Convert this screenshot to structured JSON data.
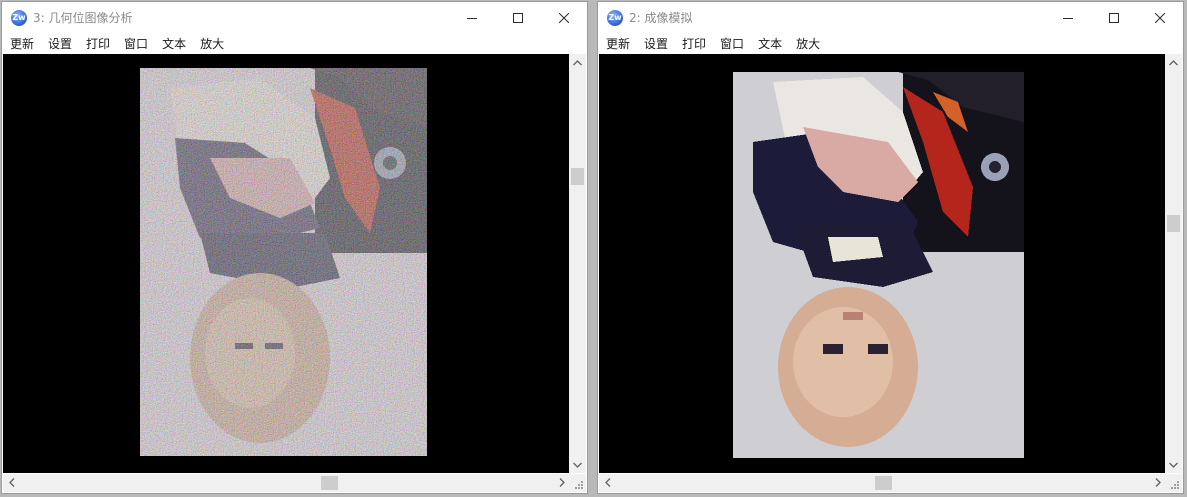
{
  "windows": [
    {
      "title": "3: 几何位图像分析",
      "app_icon_text": "Zw",
      "menu": [
        "更新",
        "设置",
        "打印",
        "窗口",
        "文本",
        "放大"
      ],
      "style": "noisy"
    },
    {
      "title": "2: 成像模拟",
      "app_icon_text": "Zw",
      "menu": [
        "更新",
        "设置",
        "打印",
        "窗口",
        "文本",
        "放大"
      ],
      "style": "clean"
    }
  ],
  "icons": {
    "minimize": "minimize-icon",
    "maximize": "maximize-icon",
    "close": "close-icon",
    "scroll_up": "chevron-up-icon",
    "scroll_down": "chevron-down-icon",
    "scroll_left": "chevron-left-icon",
    "scroll_right": "chevron-right-icon"
  },
  "colors": {
    "client_background": "#000000",
    "scrollbar_track": "#f0f0f0",
    "scrollbar_thumb": "#cdcdcd"
  }
}
